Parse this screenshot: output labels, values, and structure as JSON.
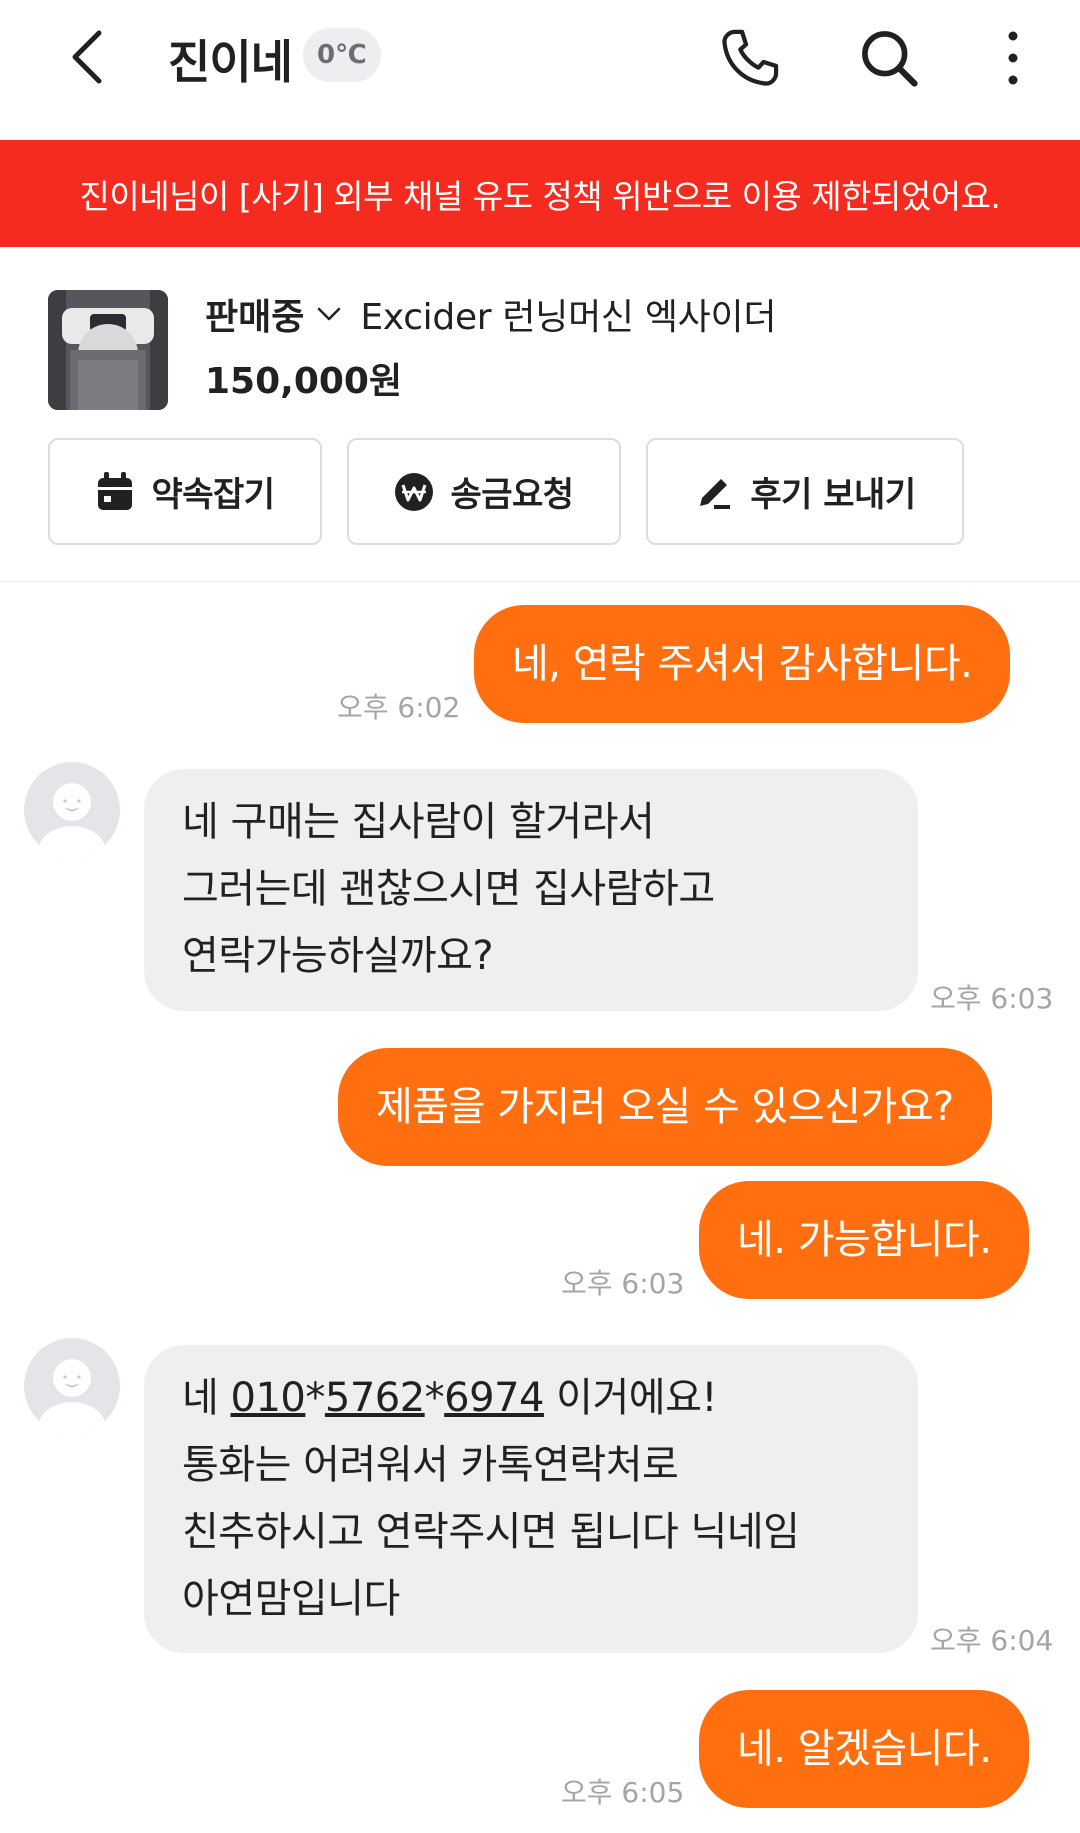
{
  "header": {
    "title": "진이네",
    "temperature": "0℃"
  },
  "banner": {
    "text": "진이네님이 [사기] 외부 채널 유도 정책 위반으로 이용 제한되었어요."
  },
  "product": {
    "status": "판매중",
    "name": "Excider 런닝머신 엑사이더",
    "price": "150,000원"
  },
  "actions": {
    "appointment": "약속잡기",
    "remit": "송금요청",
    "review": "후기 보내기"
  },
  "messages": [
    {
      "sender": "me",
      "text": "네, 연락 주셔서 감사합니다.",
      "time": "오후 6:02"
    },
    {
      "sender": "other",
      "lines": [
        "네 구매는 집사람이 할거라서",
        "그러는데 괜찮으시면 집사람하고",
        "연락가능하실까요?"
      ],
      "time": "오후 6:03"
    },
    {
      "sender": "me",
      "text": "제품을 가지러 오실 수 있으신가요?",
      "time": ""
    },
    {
      "sender": "me",
      "text": "네. 가능합니다.",
      "time": "오후 6:03"
    },
    {
      "sender": "other",
      "line1": {
        "prefix": "네 ",
        "p1": "010",
        "s1": "*",
        "p2": "5762",
        "s2": "*",
        "p3": "6974",
        "suffix": " 이거에요!"
      },
      "lines": [
        "통화는 어려워서 카톡연락처로",
        "친추하시고 연락주시면 됩니다 닉네임",
        "아연맘입니다"
      ],
      "time": "오후 6:04"
    },
    {
      "sender": "me",
      "text": "네. 알겠습니다.",
      "time": "오후 6:05"
    }
  ],
  "colors": {
    "accent": "#ff6f0f",
    "banner": "#f42b1e",
    "incoming_bubble": "#eeeff1"
  }
}
